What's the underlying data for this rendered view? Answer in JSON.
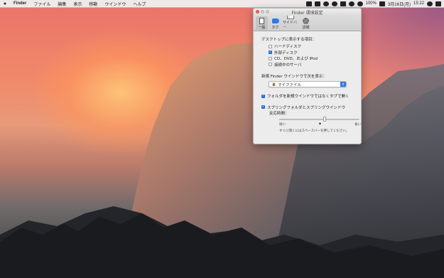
{
  "menubar": {
    "apple": "",
    "items": [
      "Finder",
      "ファイル",
      "編集",
      "表示",
      "移動",
      "ウインドウ",
      "ヘルプ"
    ],
    "battery": "100%",
    "date": "3月16日(月)",
    "time": "15:22"
  },
  "window": {
    "title": "Finder 環境設定",
    "toolbar": [
      {
        "label": "一般",
        "icon": "general-icon",
        "selected": true
      },
      {
        "label": "タグ",
        "icon": "tag-icon",
        "selected": false
      },
      {
        "label": "サイドバー",
        "icon": "sidebar-icon",
        "selected": false
      },
      {
        "label": "詳細",
        "icon": "gear-icon",
        "selected": false
      }
    ],
    "desktop_section": {
      "label": "デスクトップに表示する項目：",
      "items": [
        {
          "label": "ハードディスク",
          "checked": false
        },
        {
          "label": "外部ディスク",
          "checked": true
        },
        {
          "label": "CD、DVD、および iPod",
          "checked": false
        },
        {
          "label": "接続中のサーバ",
          "checked": false
        }
      ]
    },
    "new_window_label": "新規 Finder ウインドウで次を表示：",
    "new_window_value": "マイファイル",
    "open_in_tabs": {
      "label": "フォルダを新規ウインドウではなくタブで開く",
      "checked": true
    },
    "spring": {
      "label": "スプリングフォルダとスプリングウインドウ",
      "checked": true,
      "delay_label": "反応時間：",
      "short": "短い",
      "long": "長い",
      "value": 0.57,
      "hint": "すぐに開くにはスペースバーを押してください。"
    }
  }
}
